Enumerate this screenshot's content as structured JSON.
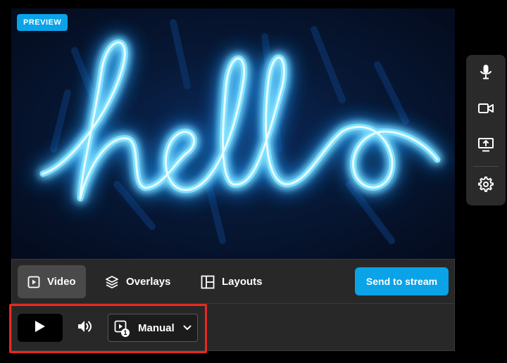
{
  "preview": {
    "badge": "PREVIEW",
    "neon_text": "hello"
  },
  "tabs": [
    {
      "label": "Video",
      "icon": "play-square-icon",
      "active": true
    },
    {
      "label": "Overlays",
      "icon": "layers-icon",
      "active": false
    },
    {
      "label": "Layouts",
      "icon": "layout-icon",
      "active": false
    }
  ],
  "send_button": "Send to stream",
  "controls": {
    "play_icon": "play-icon",
    "volume_icon": "volume-icon",
    "mode_value": "Manual",
    "mode_badge": "1"
  },
  "side_panel": {
    "icons": [
      "microphone-icon",
      "camera-icon",
      "screen-share-icon",
      "gear-icon"
    ]
  },
  "colors": {
    "accent": "#0aa3e8",
    "highlight": "#e8291f",
    "panel": "#282828"
  }
}
